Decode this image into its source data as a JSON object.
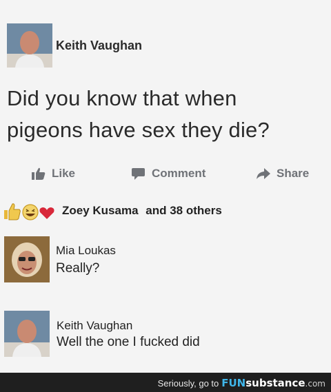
{
  "post": {
    "author": "Keith Vaughan",
    "text_line1": "Did you know that when",
    "text_line2": "pigeons have sex they die?"
  },
  "actions": {
    "like": "Like",
    "comment": "Comment",
    "share": "Share"
  },
  "reactions": {
    "name": "Zoey Kusama",
    "others": "and 38 others"
  },
  "comments": [
    {
      "author": "Mia Loukas",
      "text": "Really?"
    },
    {
      "author": "Keith Vaughan",
      "text": "Well the one I fucked did"
    }
  ],
  "footer": {
    "caption": "Seriously, go to",
    "brand_fun": "FUN",
    "brand_rest": "substance",
    "brand_tld": ".com"
  },
  "colors": {
    "background": "#f4f4f4",
    "action_gray": "#6f7277",
    "heart": "#d8283a",
    "like_yellow": "#e8b73a",
    "footer_bg": "#1f1f1f",
    "brand_blue": "#3fb6ea"
  }
}
